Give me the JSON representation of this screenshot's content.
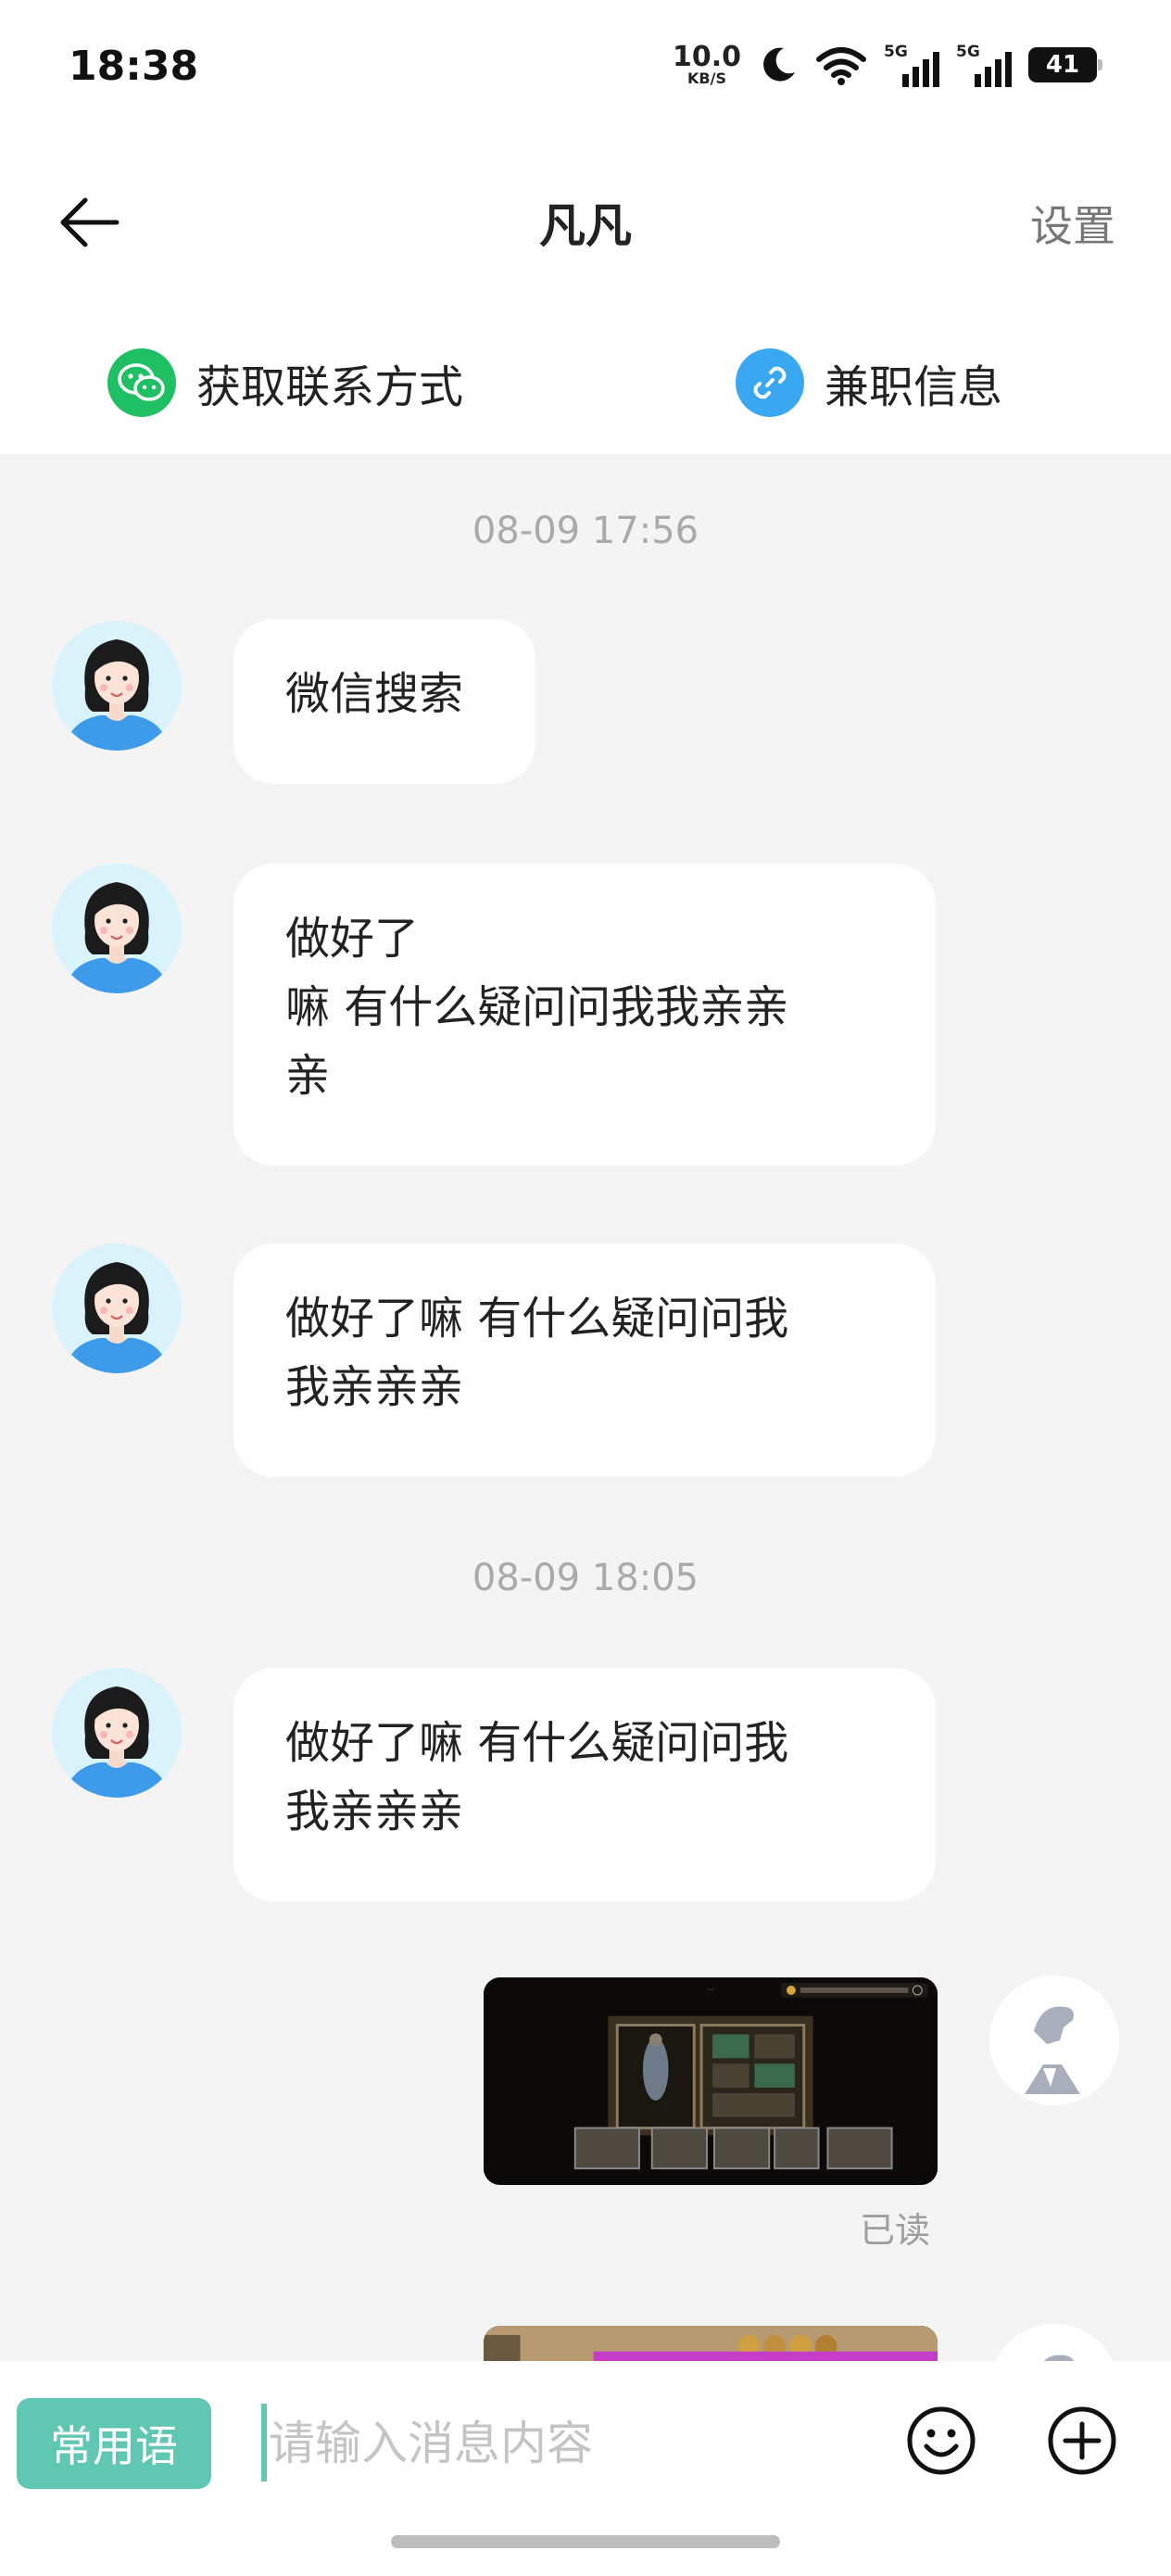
{
  "status_bar": {
    "time": "18:38",
    "net_speed_value": "10.0",
    "net_speed_unit": "KB/S",
    "signal_1_label": "5G",
    "signal_2_label": "5G",
    "battery_level": "41"
  },
  "header": {
    "title": "凡凡",
    "settings_label": "设置"
  },
  "quick_actions": {
    "contact_label": "获取联系方式",
    "jobinfo_label": "兼职信息"
  },
  "messages": {
    "timestamp_1": "08-09 17:56",
    "msg_1": "微信搜索",
    "msg_2_line_1": "做好了",
    "msg_2_line_2": "嘛 有什么疑问问我我亲亲",
    "msg_2_line_3": "亲",
    "msg_3_line_1": "做好了嘛 有什么疑问问我",
    "msg_3_line_2": "我亲亲亲",
    "timestamp_2": "08-09 18:05",
    "msg_4_line_1": "做好了嘛 有什么疑问问我",
    "msg_4_line_2": "我亲亲亲",
    "read_label": "已读"
  },
  "input_bar": {
    "phrases_label": "常用语",
    "placeholder": "请输入消息内容",
    "value": ""
  },
  "colors": {
    "accent": "#5fc7b2",
    "wechat_green": "#1fc064",
    "link_blue": "#3aa7f3",
    "chat_background": "#f4f4f4"
  },
  "icons": {
    "back": "arrow-left-icon",
    "wechat": "wechat-icon",
    "link": "link-icon",
    "emoji": "smiley-icon",
    "more": "plus-circle-icon"
  }
}
